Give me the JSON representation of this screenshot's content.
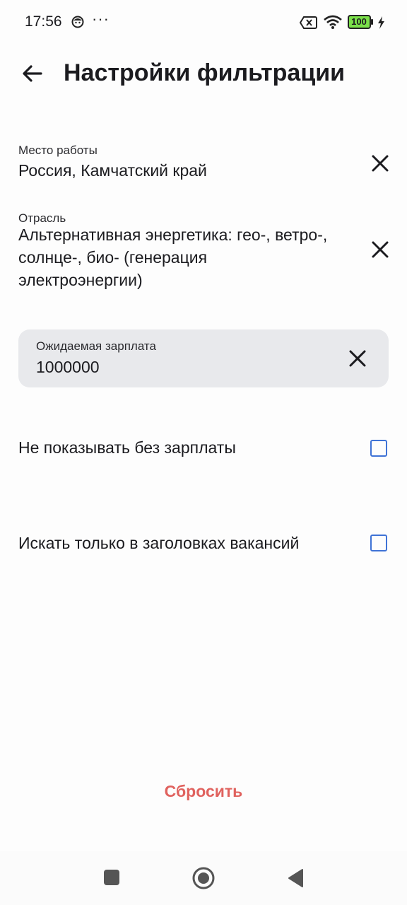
{
  "status_bar": {
    "time": "17:56",
    "dots": "···",
    "battery": "100",
    "icons": [
      "smiley-face-icon",
      "sim-error-icon",
      "wifi-icon",
      "battery-icon",
      "charging-bolt-icon"
    ]
  },
  "header": {
    "title": "Настройки фильтрации",
    "back_icon": "arrow-left-icon"
  },
  "filters": {
    "workplace": {
      "label": "Место работы",
      "value": "Россия, Камчатский край"
    },
    "industry": {
      "label": "Отрасль",
      "value_lines": [
        "Альтернативная энергетика: гео-, ветро-,",
        "солнце-, био- (генерация",
        "электроэнергии)"
      ]
    },
    "salary": {
      "label": "Ожидаемая зарплата",
      "value": "1000000"
    },
    "hide_without_salary": {
      "label": "Не показывать без зарплаты",
      "checked": false
    },
    "search_titles_only": {
      "label": "Искать только в заголовках вакансий",
      "checked": false
    }
  },
  "reset_label": "Сбросить",
  "colors": {
    "accent_checkbox": "#3f73d6",
    "reset_text": "#e0625e",
    "salary_card_bg": "#e8e9ec"
  }
}
